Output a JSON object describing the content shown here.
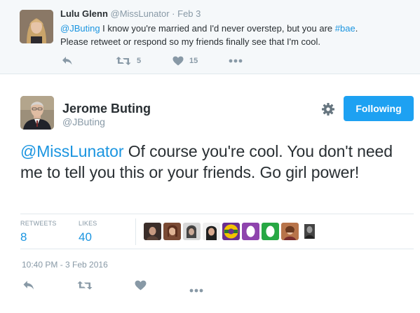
{
  "parent_tweet": {
    "name": "Lulu Glenn",
    "handle": "@MissLunator",
    "separator": "·",
    "date": "Feb 3",
    "text": {
      "mention": "@JButing",
      "part1": " I know you're married and I'd never overstep, but you are ",
      "hashtag": "#bae",
      "part2": ".",
      "line2": "Please retweet or respond so my friends finally see that I'm cool."
    },
    "actions": {
      "retweet_count": "5",
      "like_count": "15"
    }
  },
  "main_tweet": {
    "name": "Jerome Buting",
    "handle": "@JButing",
    "follow_label": "Following",
    "text": {
      "mention": "@MissLunator",
      "body": " Of course you're cool. You don't need me to tell you this or your friends. Go girl power!"
    },
    "stats": {
      "retweets_label": "RETWEETS",
      "retweets_value": "8",
      "likes_label": "LIKES",
      "likes_value": "40"
    },
    "timestamp": "10:40 PM - 3 Feb 2016"
  },
  "colors": {
    "accent": "#1da1f2",
    "link": "#1b95e0",
    "muted": "#8899a6",
    "parent_background": "#f5f8fa",
    "border": "#e1e8ed"
  },
  "icons": [
    "reply-icon",
    "retweet-icon",
    "like-icon",
    "more-icon",
    "gear-icon"
  ]
}
